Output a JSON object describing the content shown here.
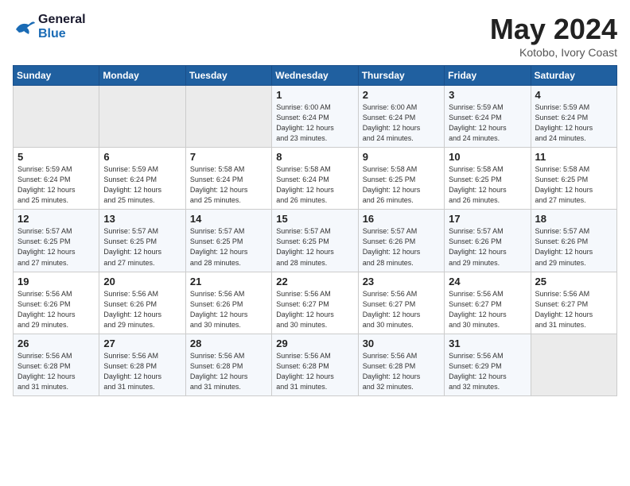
{
  "header": {
    "logo_line1": "General",
    "logo_line2": "Blue",
    "month_year": "May 2024",
    "location": "Kotobo, Ivory Coast"
  },
  "days_of_week": [
    "Sunday",
    "Monday",
    "Tuesday",
    "Wednesday",
    "Thursday",
    "Friday",
    "Saturday"
  ],
  "weeks": [
    [
      {
        "day": "",
        "info": ""
      },
      {
        "day": "",
        "info": ""
      },
      {
        "day": "",
        "info": ""
      },
      {
        "day": "1",
        "info": "Sunrise: 6:00 AM\nSunset: 6:24 PM\nDaylight: 12 hours\nand 23 minutes."
      },
      {
        "day": "2",
        "info": "Sunrise: 6:00 AM\nSunset: 6:24 PM\nDaylight: 12 hours\nand 24 minutes."
      },
      {
        "day": "3",
        "info": "Sunrise: 5:59 AM\nSunset: 6:24 PM\nDaylight: 12 hours\nand 24 minutes."
      },
      {
        "day": "4",
        "info": "Sunrise: 5:59 AM\nSunset: 6:24 PM\nDaylight: 12 hours\nand 24 minutes."
      }
    ],
    [
      {
        "day": "5",
        "info": "Sunrise: 5:59 AM\nSunset: 6:24 PM\nDaylight: 12 hours\nand 25 minutes."
      },
      {
        "day": "6",
        "info": "Sunrise: 5:59 AM\nSunset: 6:24 PM\nDaylight: 12 hours\nand 25 minutes."
      },
      {
        "day": "7",
        "info": "Sunrise: 5:58 AM\nSunset: 6:24 PM\nDaylight: 12 hours\nand 25 minutes."
      },
      {
        "day": "8",
        "info": "Sunrise: 5:58 AM\nSunset: 6:24 PM\nDaylight: 12 hours\nand 26 minutes."
      },
      {
        "day": "9",
        "info": "Sunrise: 5:58 AM\nSunset: 6:25 PM\nDaylight: 12 hours\nand 26 minutes."
      },
      {
        "day": "10",
        "info": "Sunrise: 5:58 AM\nSunset: 6:25 PM\nDaylight: 12 hours\nand 26 minutes."
      },
      {
        "day": "11",
        "info": "Sunrise: 5:58 AM\nSunset: 6:25 PM\nDaylight: 12 hours\nand 27 minutes."
      }
    ],
    [
      {
        "day": "12",
        "info": "Sunrise: 5:57 AM\nSunset: 6:25 PM\nDaylight: 12 hours\nand 27 minutes."
      },
      {
        "day": "13",
        "info": "Sunrise: 5:57 AM\nSunset: 6:25 PM\nDaylight: 12 hours\nand 27 minutes."
      },
      {
        "day": "14",
        "info": "Sunrise: 5:57 AM\nSunset: 6:25 PM\nDaylight: 12 hours\nand 28 minutes."
      },
      {
        "day": "15",
        "info": "Sunrise: 5:57 AM\nSunset: 6:25 PM\nDaylight: 12 hours\nand 28 minutes."
      },
      {
        "day": "16",
        "info": "Sunrise: 5:57 AM\nSunset: 6:26 PM\nDaylight: 12 hours\nand 28 minutes."
      },
      {
        "day": "17",
        "info": "Sunrise: 5:57 AM\nSunset: 6:26 PM\nDaylight: 12 hours\nand 29 minutes."
      },
      {
        "day": "18",
        "info": "Sunrise: 5:57 AM\nSunset: 6:26 PM\nDaylight: 12 hours\nand 29 minutes."
      }
    ],
    [
      {
        "day": "19",
        "info": "Sunrise: 5:56 AM\nSunset: 6:26 PM\nDaylight: 12 hours\nand 29 minutes."
      },
      {
        "day": "20",
        "info": "Sunrise: 5:56 AM\nSunset: 6:26 PM\nDaylight: 12 hours\nand 29 minutes."
      },
      {
        "day": "21",
        "info": "Sunrise: 5:56 AM\nSunset: 6:26 PM\nDaylight: 12 hours\nand 30 minutes."
      },
      {
        "day": "22",
        "info": "Sunrise: 5:56 AM\nSunset: 6:27 PM\nDaylight: 12 hours\nand 30 minutes."
      },
      {
        "day": "23",
        "info": "Sunrise: 5:56 AM\nSunset: 6:27 PM\nDaylight: 12 hours\nand 30 minutes."
      },
      {
        "day": "24",
        "info": "Sunrise: 5:56 AM\nSunset: 6:27 PM\nDaylight: 12 hours\nand 30 minutes."
      },
      {
        "day": "25",
        "info": "Sunrise: 5:56 AM\nSunset: 6:27 PM\nDaylight: 12 hours\nand 31 minutes."
      }
    ],
    [
      {
        "day": "26",
        "info": "Sunrise: 5:56 AM\nSunset: 6:28 PM\nDaylight: 12 hours\nand 31 minutes."
      },
      {
        "day": "27",
        "info": "Sunrise: 5:56 AM\nSunset: 6:28 PM\nDaylight: 12 hours\nand 31 minutes."
      },
      {
        "day": "28",
        "info": "Sunrise: 5:56 AM\nSunset: 6:28 PM\nDaylight: 12 hours\nand 31 minutes."
      },
      {
        "day": "29",
        "info": "Sunrise: 5:56 AM\nSunset: 6:28 PM\nDaylight: 12 hours\nand 31 minutes."
      },
      {
        "day": "30",
        "info": "Sunrise: 5:56 AM\nSunset: 6:28 PM\nDaylight: 12 hours\nand 32 minutes."
      },
      {
        "day": "31",
        "info": "Sunrise: 5:56 AM\nSunset: 6:29 PM\nDaylight: 12 hours\nand 32 minutes."
      },
      {
        "day": "",
        "info": ""
      }
    ]
  ]
}
